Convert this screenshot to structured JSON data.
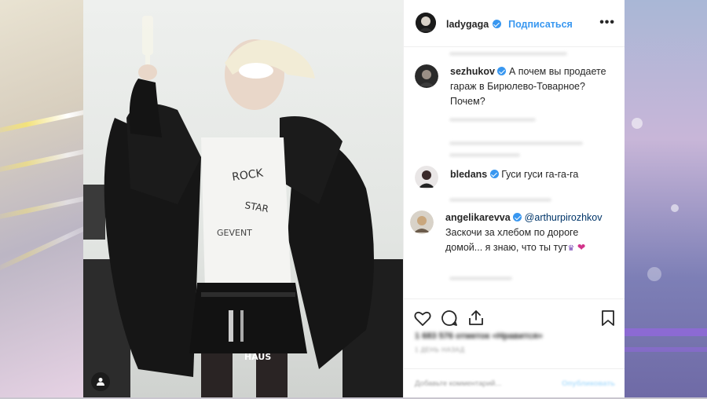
{
  "header": {
    "username": "ladygaga",
    "follow_label": "Подписаться",
    "more_label": "•••"
  },
  "comments": [
    {
      "username": "sezhukov",
      "text": "А почем вы продаете гараж в Бирюлево-Товарное? Почем?"
    },
    {
      "username": "bledans",
      "text": "Гуси гуси га-га-га"
    },
    {
      "username": "angelikarevva",
      "mention": "@arthurpirozhkov",
      "text": "Заскочи за хлебом по дороге домой... я знаю, что ты тут",
      "emoji_heart": "❤"
    }
  ],
  "actions": {
    "likes_text": "1 683 576 отметок «Нравится»",
    "date_text": "1 ДЕНЬ НАЗАД"
  },
  "add_comment": {
    "placeholder": "Добавьте комментарий...",
    "publish_label": "Опубликовать"
  },
  "photo": {
    "bag_text": "HAUS"
  },
  "colors": {
    "accent": "#3897f0",
    "text": "#262626",
    "heart": "#d2338a"
  }
}
